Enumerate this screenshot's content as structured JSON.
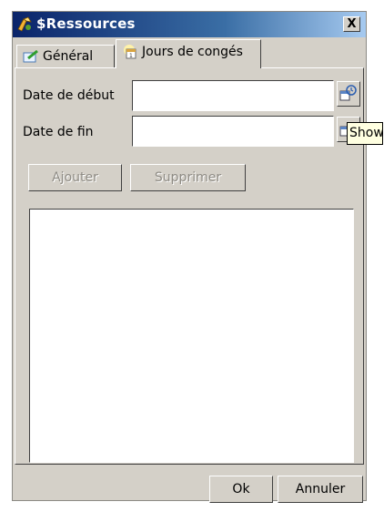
{
  "window": {
    "title": "$Ressources",
    "close_label": "X"
  },
  "tabs": [
    {
      "label": "Général",
      "icon": "general-icon",
      "active": false
    },
    {
      "label": "Jours de congés",
      "icon": "calendar-icon",
      "active": true
    }
  ],
  "form": {
    "start_label": "Date de début",
    "start_value": "",
    "end_label": "Date de fin",
    "end_value": "",
    "tooltip": "Show"
  },
  "actions": {
    "add_label": "Ajouter",
    "remove_label": "Supprimer"
  },
  "footer": {
    "ok_label": "Ok",
    "cancel_label": "Annuler"
  },
  "colors": {
    "face": "#d4d0c8",
    "title_start": "#0a246a",
    "title_end": "#a6caf0",
    "tooltip": "#ffffe1"
  }
}
